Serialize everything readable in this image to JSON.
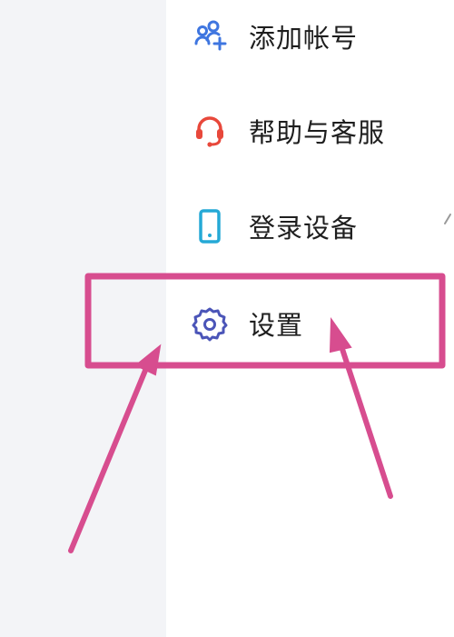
{
  "menu": {
    "items": [
      {
        "label": "添加帐号",
        "icon": "add-account-icon"
      },
      {
        "label": "帮助与客服",
        "icon": "headset-icon"
      },
      {
        "label": "登录设备",
        "icon": "phone-device-icon"
      },
      {
        "label": "设置",
        "icon": "gear-icon"
      }
    ]
  },
  "colors": {
    "blue": "#3f76e0",
    "red": "#e8483b",
    "teal": "#25a9d6",
    "indigo": "#4b55b8",
    "annotation": "#d74d8f"
  }
}
